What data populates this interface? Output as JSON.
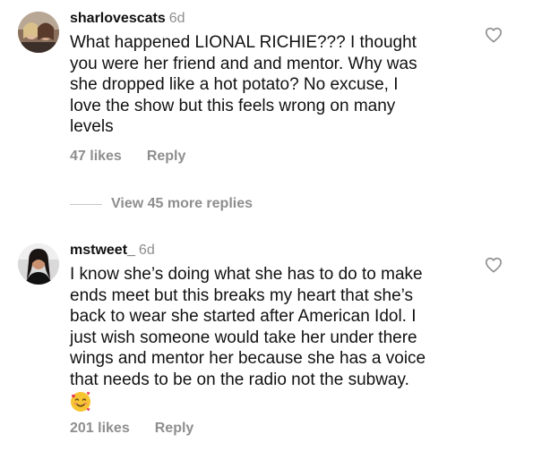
{
  "comments": [
    {
      "username": "sharlovescats",
      "time": "6d",
      "text": "What happened LIONAL RICHIE??? I thought\nyou were her friend and and mentor. Why was\nshe dropped like a hot potato? No excuse, I\nlove the show but this feels wrong on many\nlevels",
      "likes": "47 likes",
      "reply": "Reply",
      "avatar_icon": "profile-photo-two-people",
      "like_icon": "heart-outline-icon"
    },
    {
      "username": "mstweet_",
      "time": "6d",
      "text": "I know she’s doing what she has to do to make\nends meet but this breaks my heart that she’s\nback to wear she started after American Idol. I\njust wish someone would take her under there\nwings and mentor her because she has a voice\nthat needs to be on the radio not the subway.",
      "emoji": "🥰",
      "likes": "201 likes",
      "reply": "Reply",
      "avatar_icon": "profile-photo-person",
      "like_icon": "heart-outline-icon"
    }
  ],
  "view_more": "View 45 more replies",
  "colors": {
    "text": "#111111",
    "secondary": "#8e8e8e",
    "divider": "#c7c7c7"
  }
}
